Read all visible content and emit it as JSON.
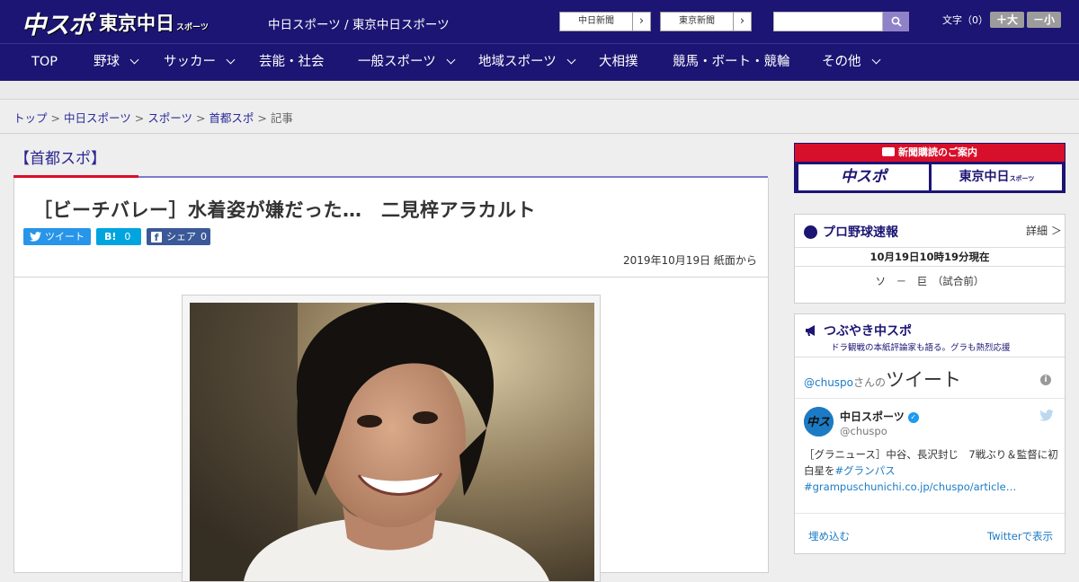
{
  "header": {
    "logo_main": "中スポ",
    "logo_tokyo": "東京中日",
    "logo_tokyo_small": "スポーツ",
    "site_title": "中日スポーツ / 東京中日スポーツ",
    "paper_links": [
      {
        "label": "中日新聞",
        "arrow": "›"
      },
      {
        "label": "東京新聞",
        "arrow": "›"
      }
    ],
    "search": {
      "value": "",
      "placeholder": ""
    },
    "font_size_label": "文字（0）",
    "font_larger": "＋大",
    "font_smaller": "－小"
  },
  "nav": {
    "items": [
      {
        "label": "TOP",
        "dropdown": false
      },
      {
        "label": "野球",
        "dropdown": true
      },
      {
        "label": "サッカー",
        "dropdown": true
      },
      {
        "label": "芸能・社会",
        "dropdown": false
      },
      {
        "label": "一般スポーツ",
        "dropdown": true
      },
      {
        "label": "地域スポーツ",
        "dropdown": true
      },
      {
        "label": "大相撲",
        "dropdown": false
      },
      {
        "label": "競馬・ボート・競輪",
        "dropdown": false
      },
      {
        "label": "その他",
        "dropdown": true
      }
    ]
  },
  "breadcrumb": {
    "items": [
      "トップ",
      "中日スポーツ",
      "スポーツ",
      "首都スポ"
    ],
    "separator": ">",
    "current": "記事"
  },
  "section": {
    "title": "【首都スポ】"
  },
  "article": {
    "headline": "［ビーチバレー］水着姿が嫌だった…　二見梓アラカルト",
    "share": {
      "tweet_label": "ツイート",
      "hatena_label": "B!",
      "hatena_count": "0",
      "facebook_label": "シェア",
      "facebook_count": "0"
    },
    "date": "2019年10月19日 紙面から"
  },
  "sidebar": {
    "subscribe": {
      "heading": "新聞購読のご案内",
      "logo_left": "中スポ",
      "logo_right": "東京中日",
      "logo_right_small": "スポーツ"
    },
    "baseball": {
      "title": "プロ野球速報",
      "detail_label": "詳細 ＞",
      "time": "10月19日10時19分現在",
      "score": "ソ　－　巨　（試合前）"
    },
    "tweets": {
      "title": "つぶやき中スポ",
      "subtitle": "ドラ観戦の本紙評論家も語る。グラも熱烈応援",
      "header_prefix": "@chuspo",
      "header_san": "さんの",
      "header_big": "ツイート",
      "tweet": {
        "name": "中日スポーツ",
        "handle": "@chuspo",
        "text": "［グラニュース］中谷、長沢封じ　7戦ぶり＆監督に初白星を",
        "hashtag": "#グランパス",
        "link": "#grampuschunichi.co.jp/chuspo/article…"
      },
      "embed_label": "埋め込む",
      "view_label": "Twitterで表示"
    }
  },
  "colors": {
    "brand_navy": "#1c1573",
    "accent_red": "#d80f2a",
    "link_blue": "#1c7bc4",
    "twitter_blue": "#2795e9",
    "hatena_blue": "#00a4de",
    "facebook_blue": "#3b5998"
  }
}
